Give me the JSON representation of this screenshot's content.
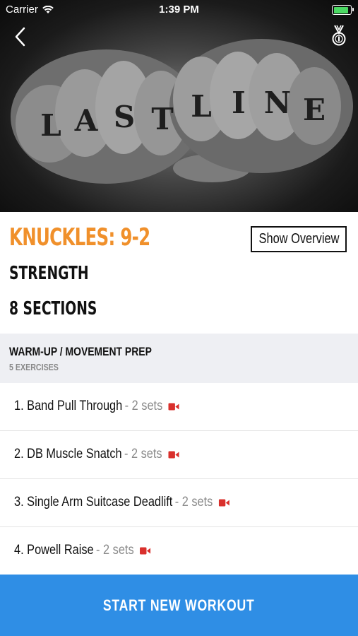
{
  "status_bar": {
    "carrier": "Carrier",
    "time": "1:39 PM",
    "battery_level": 1.0
  },
  "hero": {
    "image_icon": "tattooed-knuckles-photo",
    "tattoo_letters": [
      "L",
      "A",
      "S",
      "T",
      "L",
      "I",
      "N",
      "E"
    ]
  },
  "nav": {
    "back_icon": "chevron-left-icon",
    "medal_icon": "medal-icon"
  },
  "workout": {
    "title": "KNUCKLES: 9-2",
    "category": "STRENGTH",
    "sections_count": "8 SECTIONS",
    "overview_button": "Show Overview"
  },
  "section": {
    "name": "WARM-UP / MOVEMENT PREP",
    "exercise_count": "5 EXERCISES"
  },
  "exercises": [
    {
      "name": "1. Band Pull Through",
      "sets": "- 2 sets",
      "icon": "video-camera-icon"
    },
    {
      "name": "2. DB Muscle Snatch",
      "sets": "- 2 sets",
      "icon": "video-camera-icon"
    },
    {
      "name": "3. Single Arm Suitcase Deadlift",
      "sets": "- 2 sets",
      "icon": "video-camera-icon"
    },
    {
      "name": "4. Powell Raise",
      "sets": "- 2 sets",
      "icon": "video-camera-icon"
    }
  ],
  "footer": {
    "start_button": "START NEW WORKOUT"
  },
  "colors": {
    "accent_orange": "#f0902b",
    "primary_blue": "#2f8ee5",
    "video_red": "#d9302c",
    "battery_green": "#4cd964"
  }
}
